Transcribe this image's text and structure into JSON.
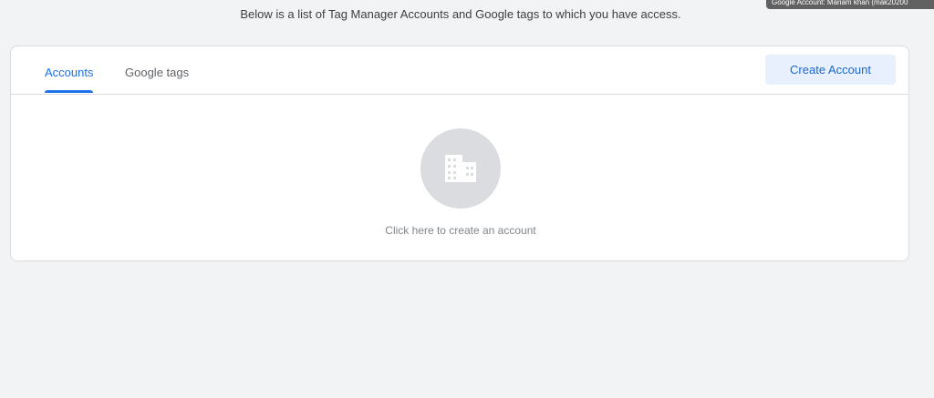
{
  "header": {
    "intro_text": "Below is a list of Tag Manager Accounts and Google tags to which you have access.",
    "tooltip_text": "Google Account: Mariam khan (mak20200"
  },
  "tabs": {
    "accounts_label": "Accounts",
    "google_tags_label": "Google tags",
    "active": "Accounts"
  },
  "toolbar": {
    "create_account_label": "Create Account"
  },
  "empty_state": {
    "icon": "building-icon",
    "message": "Click here to create an account"
  },
  "colors": {
    "accent": "#1a73e8",
    "button_bg": "#e8f0fe",
    "page_bg": "#f1f3f4"
  }
}
